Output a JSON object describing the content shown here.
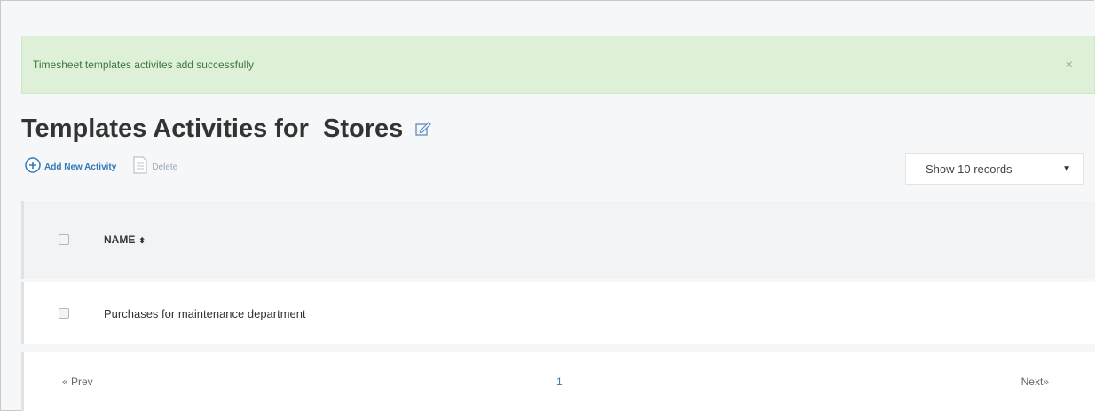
{
  "alert": {
    "message": "Timesheet templates activites add successfully",
    "close_glyph": "×",
    "close_icon": "close-icon"
  },
  "page": {
    "title": "Templates Activities for  Stores",
    "title_icon": "edit-icon"
  },
  "toolbar": {
    "add_label": "Add New Activity",
    "add_icon": "plus-circle-icon",
    "delete_label": "Delete",
    "delete_icon": "document-icon"
  },
  "records_select": {
    "value": "Show 10 records",
    "caret": "▼"
  },
  "table": {
    "columns": [
      {
        "label": "NAME",
        "sort_glyph": "⬍"
      }
    ],
    "rows": [
      {
        "name": "Purchases for maintenance department"
      }
    ]
  },
  "pagination": {
    "prev_label": "« Prev",
    "current_page": "1",
    "next_label": "Next»"
  },
  "colors": {
    "alert_bg": "#dff0d8",
    "alert_text": "#3c763d",
    "link": "#337ab7"
  }
}
